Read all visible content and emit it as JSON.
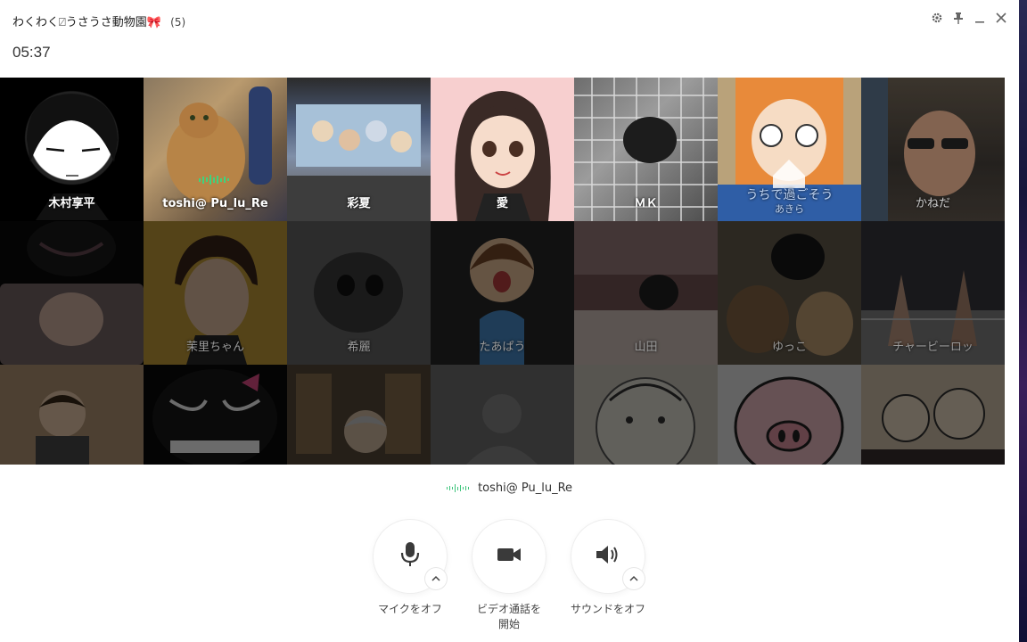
{
  "window": {
    "title": "わくわく⍁うさうさ動物園🎀",
    "member_count": "(5)",
    "timer": "05:37"
  },
  "tiles": [
    {
      "name": "木村享平",
      "active": true
    },
    {
      "name": "toshi@ Pu_lu_Re",
      "active": true,
      "speaking": true
    },
    {
      "name": "彩夏",
      "active": true
    },
    {
      "name": "愛",
      "active": true
    },
    {
      "name": "ＭＫ",
      "active": true
    },
    {
      "name": "あきら",
      "active": true,
      "overlay": "うちで過ごそう"
    },
    {
      "name": "かねだ",
      "active": true
    },
    {
      "name": "",
      "active": false
    },
    {
      "name": "茉里ちゃん",
      "active": false
    },
    {
      "name": "希麗",
      "active": false
    },
    {
      "name": "たあぱう",
      "active": false
    },
    {
      "name": "山田",
      "active": false
    },
    {
      "name": "ゆっこ",
      "active": false
    },
    {
      "name": "チャービーロッ",
      "active": false
    },
    {
      "name": "",
      "active": false
    },
    {
      "name": "",
      "active": false
    },
    {
      "name": "",
      "active": false
    },
    {
      "name": "",
      "active": false
    },
    {
      "name": "",
      "active": false
    },
    {
      "name": "",
      "active": false
    },
    {
      "name": "",
      "active": false
    }
  ],
  "current_speaker": "toshi@ Pu_lu_Re",
  "controls": {
    "mic_label": "マイクをオフ",
    "video_label_1": "ビデオ通話を",
    "video_label_2": "開始",
    "sound_label": "サウンドをオフ"
  },
  "icons": {
    "settings": "gear-icon",
    "pin": "pin-icon",
    "minimize": "minimize-icon",
    "close": "close-icon",
    "mic": "microphone-icon",
    "video": "video-camera-icon",
    "sound": "speaker-icon"
  }
}
